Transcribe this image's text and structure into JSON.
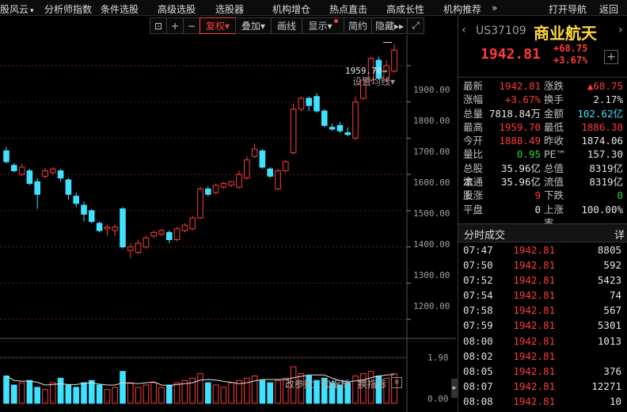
{
  "top_menu": {
    "items": [
      "股风云",
      "分析师指数",
      "条件选股",
      "高级选股",
      "选股器",
      "机构增仓",
      "热点直击",
      "高成长性",
      "机构推荐"
    ],
    "more": "»",
    "right_items": [
      "打开导航",
      "返回"
    ]
  },
  "toolbar": {
    "buttons": [
      "复权",
      "叠加",
      "画线",
      "显示",
      "简约",
      "隐藏"
    ],
    "active": "复权"
  },
  "chart": {
    "settings_label": "设置均线",
    "y_ticks": [
      "1900.00",
      "1800.00",
      "1700.00",
      "1600.00",
      "1500.00",
      "1400.00",
      "1300.00",
      "1200.00"
    ],
    "high_marker": "1959.70",
    "indicator_buttons": [
      "改参数",
      "加指标",
      "换指标"
    ],
    "indicator_close": "×",
    "vol_ticks": [
      "1.98",
      "0.00"
    ],
    "colors": {
      "up": "#ff3b3b",
      "down": "#40e0ff",
      "ma": "#ff3b3b"
    }
  },
  "chart_data": {
    "type": "candlestick",
    "ylim": [
      1150,
      1985
    ],
    "candles": [
      [
        1665,
        1635,
        1675,
        1630
      ],
      [
        1625,
        1610,
        1632,
        1605
      ],
      [
        1600,
        1620,
        1630,
        1595
      ],
      [
        1610,
        1575,
        1615,
        1570
      ],
      [
        1580,
        1545,
        1590,
        1505
      ],
      [
        1595,
        1610,
        1618,
        1590
      ],
      [
        1605,
        1615,
        1620,
        1600
      ],
      [
        1610,
        1590,
        1615,
        1580
      ],
      [
        1585,
        1545,
        1590,
        1530
      ],
      [
        1540,
        1520,
        1550,
        1510
      ],
      [
        1515,
        1490,
        1525,
        1470
      ],
      [
        1500,
        1470,
        1505,
        1465
      ],
      [
        1465,
        1445,
        1470,
        1440
      ],
      [
        1450,
        1455,
        1460,
        1430
      ],
      [
        1445,
        1455,
        1462,
        1430
      ],
      [
        1505,
        1400,
        1510,
        1395
      ],
      [
        1390,
        1400,
        1410,
        1370
      ],
      [
        1385,
        1410,
        1420,
        1380
      ],
      [
        1400,
        1425,
        1430,
        1395
      ],
      [
        1430,
        1440,
        1445,
        1425
      ],
      [
        1435,
        1445,
        1450,
        1430
      ],
      [
        1440,
        1420,
        1445,
        1410
      ],
      [
        1420,
        1450,
        1455,
        1415
      ],
      [
        1445,
        1460,
        1465,
        1440
      ],
      [
        1450,
        1480,
        1485,
        1445
      ],
      [
        1480,
        1560,
        1565,
        1478
      ],
      [
        1560,
        1545,
        1568,
        1540
      ],
      [
        1550,
        1570,
        1575,
        1545
      ],
      [
        1565,
        1575,
        1580,
        1560
      ],
      [
        1570,
        1580,
        1582,
        1565
      ],
      [
        1565,
        1600,
        1610,
        1560
      ],
      [
        1590,
        1640,
        1650,
        1585
      ],
      [
        1650,
        1670,
        1685,
        1645
      ],
      [
        1665,
        1620,
        1670,
        1615
      ],
      [
        1615,
        1595,
        1620,
        1590
      ],
      [
        1560,
        1610,
        1615,
        1555
      ],
      [
        1610,
        1635,
        1640,
        1605
      ],
      [
        1660,
        1780,
        1795,
        1655
      ],
      [
        1780,
        1810,
        1815,
        1775
      ],
      [
        1810,
        1790,
        1815,
        1775
      ],
      [
        1815,
        1775,
        1825,
        1770
      ],
      [
        1775,
        1735,
        1780,
        1730
      ],
      [
        1730,
        1725,
        1740,
        1720
      ],
      [
        1735,
        1720,
        1745,
        1715
      ],
      [
        1715,
        1710,
        1730,
        1705
      ],
      [
        1700,
        1800,
        1815,
        1695
      ],
      [
        1810,
        1860,
        1870,
        1805
      ],
      [
        1860,
        1920,
        1925,
        1855
      ],
      [
        1915,
        1865,
        1925,
        1860
      ],
      [
        1860,
        1900,
        1915,
        1855
      ],
      [
        1885,
        1942.81,
        1959.7,
        1880
      ]
    ],
    "volume": [
      1.2,
      0.8,
      0.9,
      1.0,
      0.7,
      0.6,
      0.9,
      1.1,
      0.8,
      0.7,
      0.9,
      1.0,
      0.8,
      0.6,
      0.7,
      1.4,
      0.9,
      0.7,
      0.8,
      0.9,
      0.7,
      0.8,
      0.9,
      1.0,
      1.1,
      1.3,
      0.9,
      0.8,
      0.7,
      0.9,
      1.0,
      1.1,
      1.2,
      1.0,
      0.9,
      1.0,
      1.1,
      1.6,
      1.3,
      1.2,
      1.0,
      1.1,
      0.9,
      0.8,
      0.9,
      1.2,
      1.3,
      1.4,
      1.2,
      1.1,
      1.3
    ]
  },
  "quote": {
    "code": "US37109",
    "name": "商业航天",
    "price": "1942.81",
    "change": "+68.75",
    "change_pct": "+3.67%",
    "plus_label": "+",
    "stats": [
      {
        "l1": "最新",
        "v1": "1942.81",
        "c1": "red",
        "l2": "涨跌",
        "v2": "▲68.75",
        "c2": "red"
      },
      {
        "l1": "涨幅",
        "v1": "+3.67%",
        "c1": "red",
        "l2": "换手",
        "v2": "2.17%",
        "c2": "wht"
      },
      {
        "l1": "总量",
        "v1": "7818.84万",
        "c1": "wht",
        "l2": "金额",
        "v2": "102.62亿",
        "c2": "cyn"
      },
      {
        "l1": "最高",
        "v1": "1959.70",
        "c1": "red",
        "l2": "最低",
        "v2": "1886.30",
        "c2": "red"
      },
      {
        "l1": "今开",
        "v1": "1888.49",
        "c1": "red",
        "l2": "昨收",
        "v2": "1874.06",
        "c2": "wht"
      },
      {
        "l1": "量比",
        "v1": "0.95",
        "c1": "grn",
        "l2": "PE™",
        "v2": "157.30",
        "c2": "wht"
      },
      {
        "l1": "总股本",
        "v1": "35.96亿",
        "c1": "wht",
        "l2": "总值",
        "v2": "8319亿",
        "c2": "wht"
      },
      {
        "l1": "流通股",
        "v1": "35.96亿",
        "c1": "wht",
        "l2": "流值",
        "v2": "8319亿",
        "c2": "wht"
      },
      {
        "l1": "上涨",
        "v1": "9",
        "c1": "red",
        "l2": "下跌",
        "v2": "0",
        "c2": "grn"
      },
      {
        "l1": "平盘",
        "v1": "0",
        "c1": "wht",
        "l2": "上涨率",
        "v2": "100.00%",
        "c2": "wht"
      }
    ]
  },
  "trades": {
    "title": "分时成交",
    "detail": "详",
    "rows": [
      {
        "time": "07:47",
        "price": "1942.81",
        "vol": "8805"
      },
      {
        "time": "07:50",
        "price": "1942.81",
        "vol": "592"
      },
      {
        "time": "07:52",
        "price": "1942.81",
        "vol": "5423"
      },
      {
        "time": "07:54",
        "price": "1942.81",
        "vol": "74"
      },
      {
        "time": "07:58",
        "price": "1942.81",
        "vol": "567"
      },
      {
        "time": "07:59",
        "price": "1942.81",
        "vol": "5301"
      },
      {
        "time": "08:00",
        "price": "1942.81",
        "vol": "1013"
      },
      {
        "time": "08:02",
        "price": "1942.81",
        "vol": ""
      },
      {
        "time": "08:05",
        "price": "1942.81",
        "vol": "376"
      },
      {
        "time": "08:07",
        "price": "1942.81",
        "vol": "12271"
      },
      {
        "time": "08:08",
        "price": "1942.81",
        "vol": "10"
      }
    ]
  }
}
